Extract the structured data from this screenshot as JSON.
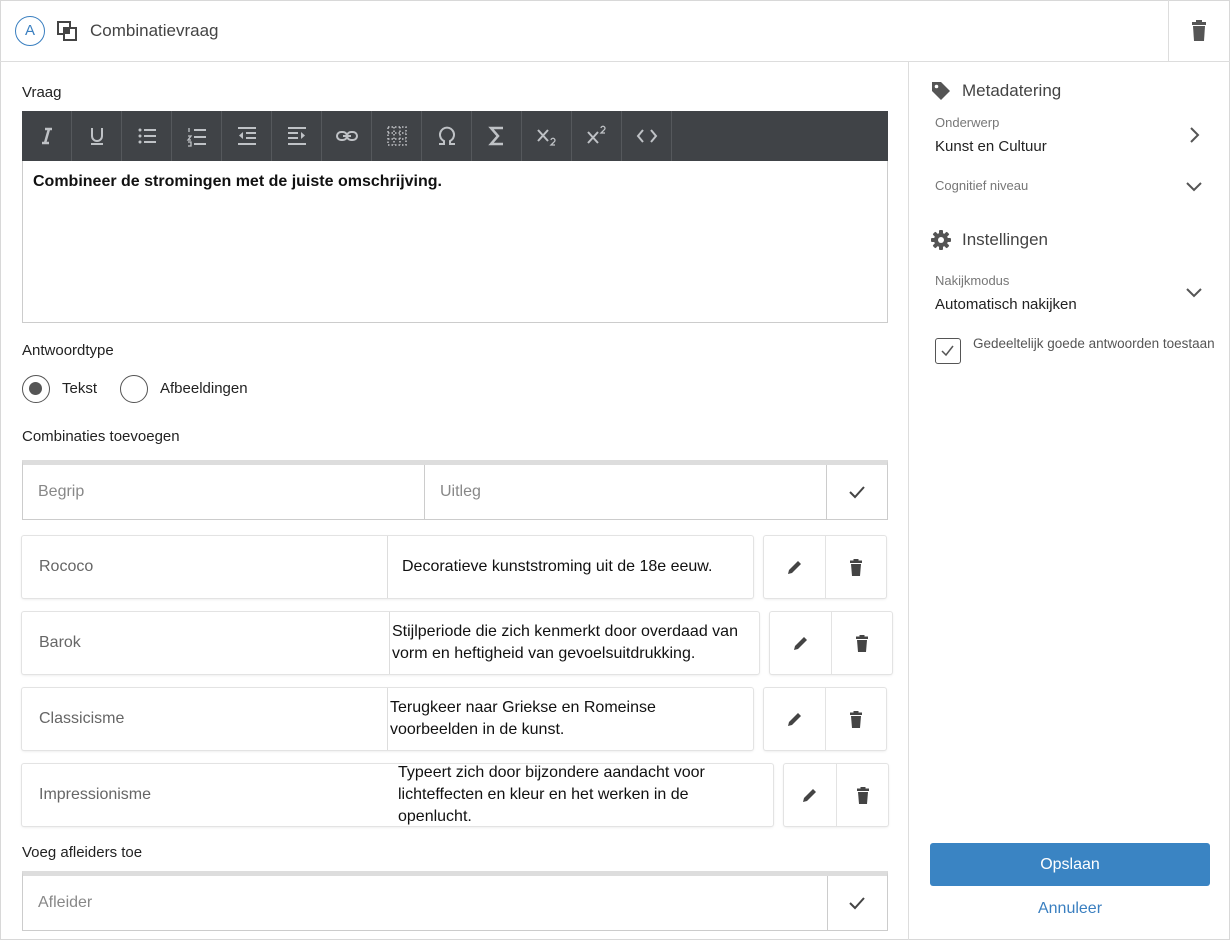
{
  "header": {
    "badge": "A",
    "title": "Combinatievraag"
  },
  "main": {
    "question_label": "Vraag",
    "question_text": "Combineer de stromingen met de juiste omschrijving.",
    "answer_type_label": "Antwoordtype",
    "answer_types": [
      {
        "label": "Tekst",
        "selected": true
      },
      {
        "label": "Afbeeldingen",
        "selected": false
      }
    ],
    "add_combinations_label": "Combinaties toevoegen",
    "new_combination": {
      "term_placeholder": "Begrip",
      "explanation_placeholder": "Uitleg"
    },
    "combinations": [
      {
        "term": "Rococo",
        "explanation": "Decoratieve kunststroming uit de 18e eeuw."
      },
      {
        "term": "Barok",
        "explanation": "Stijlperiode die zich kenmerkt door overdaad van vorm en heftigheid van gevoelsuitdrukking."
      },
      {
        "term": "Classicisme",
        "explanation": "Terugkeer naar Griekse en Romeinse voorbeelden in de kunst."
      },
      {
        "term": "Impressionisme",
        "explanation": "Typeert zich door bijzondere aandacht voor lichteffecten en kleur en het werken in de openlucht."
      }
    ],
    "distractors_label": "Voeg afleiders toe",
    "distractor_placeholder": "Afleider"
  },
  "toolbar": {
    "icons": [
      "italic-icon",
      "underline-icon",
      "bullet-list-icon",
      "numbered-list-icon",
      "outdent-icon",
      "indent-icon",
      "link-icon",
      "table-icon",
      "omega-icon",
      "sigma-icon",
      "subscript-icon",
      "superscript-icon",
      "code-icon"
    ]
  },
  "side": {
    "metadata_title": "Metadatering",
    "subject_label": "Onderwerp",
    "subject_value": "Kunst en Cultuur",
    "cognitive_label": "Cognitief niveau",
    "settings_title": "Instellingen",
    "grading_label": "Nakijkmodus",
    "grading_value": "Automatisch nakijken",
    "partial_label": "Gedeeltelijk goede antwoorden toestaan",
    "partial_checked": true,
    "save_label": "Opslaan",
    "cancel_label": "Annuleer"
  },
  "colors": {
    "accent": "#3a84c3",
    "toolbar_bg": "#404347",
    "icon": "#555555"
  }
}
